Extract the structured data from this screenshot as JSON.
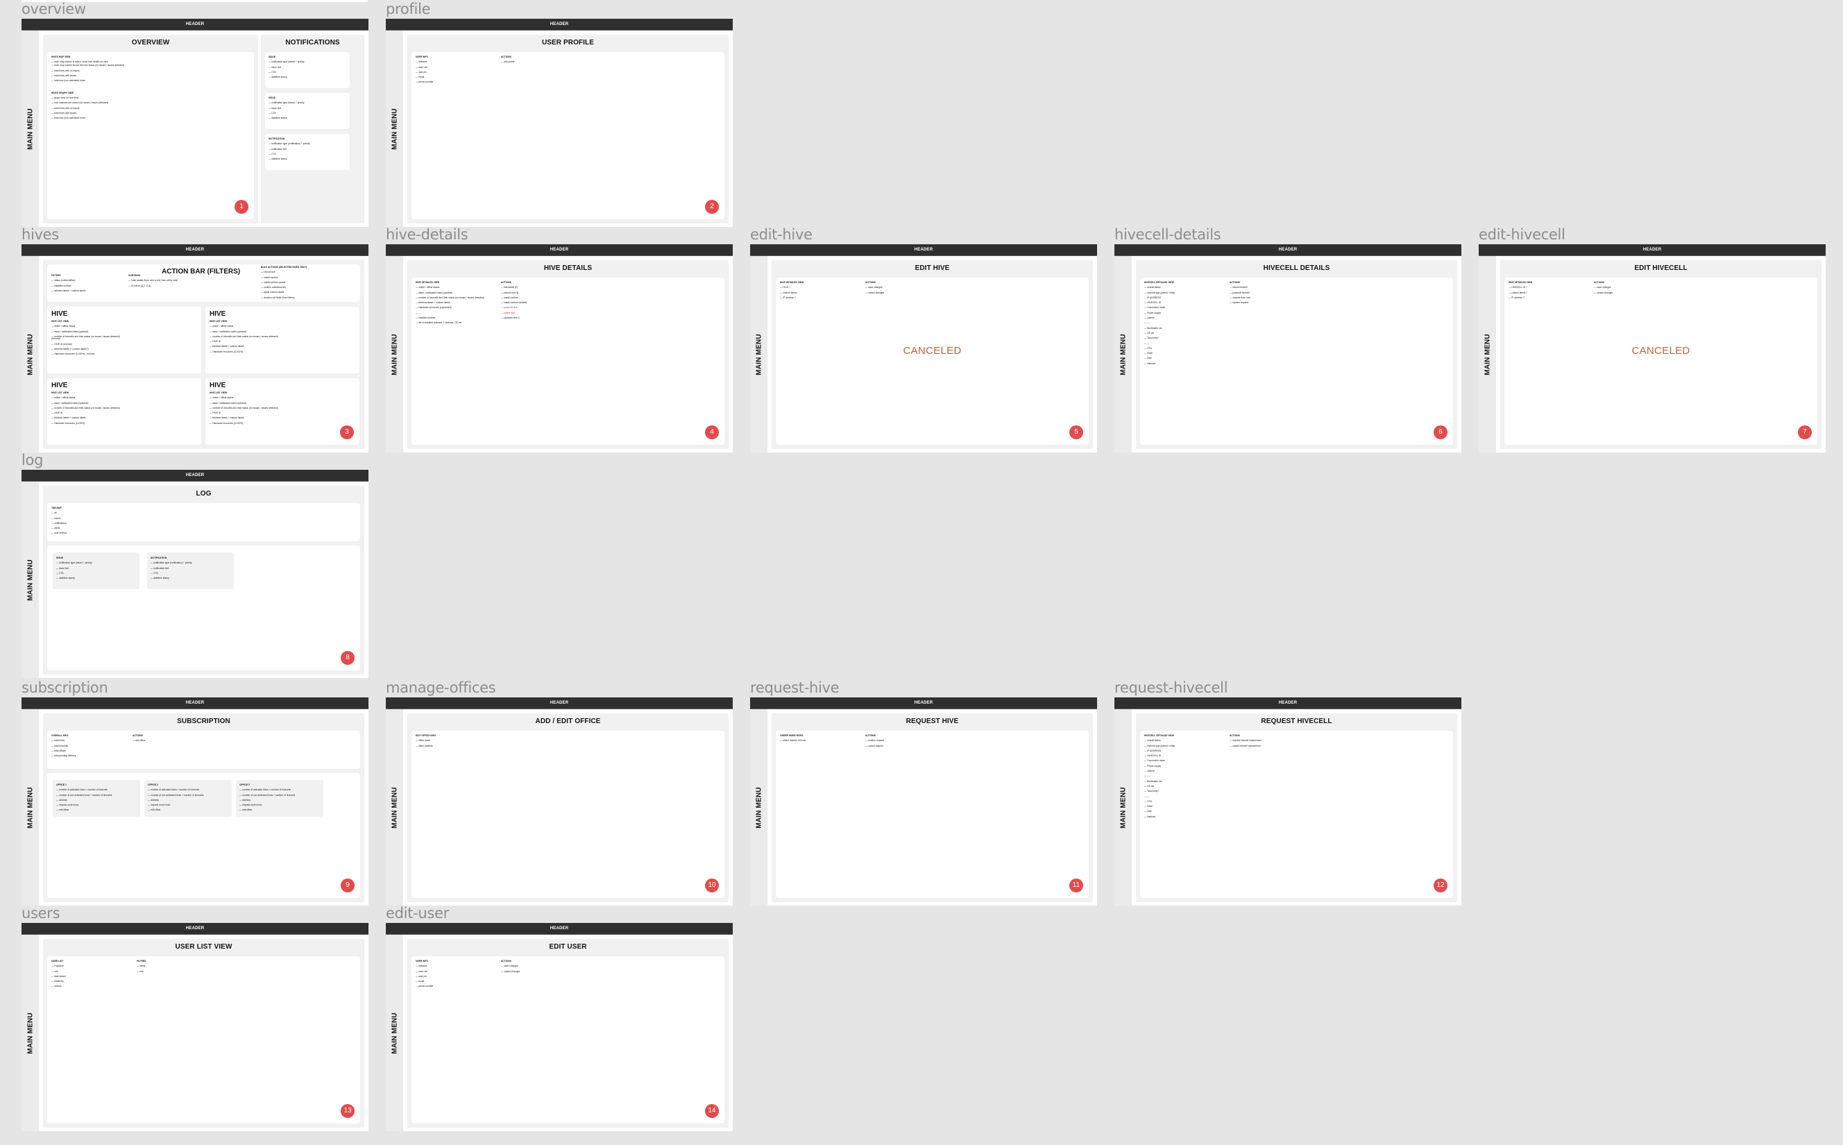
{
  "canvas": {
    "background": "#e5e5e5"
  },
  "common": {
    "header_label": "HEADER",
    "sidebar_label": "MAIN MENU",
    "badge_color": "#e34b4b",
    "canceled_color": "#d35b3a"
  },
  "frames": {
    "overview": {
      "label": "overview",
      "badge": "1",
      "title": "OVERVIEW",
      "sections": [
        {
          "heading": "HIVES MAP VIEW",
          "items": [
            "each map marker is active, show hive details on click",
            "each map marker shows the hive status (no issues / issues detected)",
            "total hives with no issues",
            "total hives with issues",
            "total new (non-activated) hives"
          ]
        },
        {
          "heading": "HIVES GRAPH VIEW",
          "items": [
            "graph view on hive level",
            "hive statuses are shown (no issues / issues detected)",
            "total hives with no issues",
            "total hives with issues",
            "total new (non-activated) hives"
          ]
        }
      ],
      "notifications": {
        "title": "NOTIFICATIONS",
        "cards": [
          {
            "heading": "ISSUE",
            "items": [
              "notification type (issue) + priority",
              "issue text",
              "CTA",
              "datetime stamp"
            ]
          },
          {
            "heading": "ISSUE",
            "items": [
              "notification type (issue) + priority",
              "issue text",
              "CTA",
              "datetime stamp"
            ]
          },
          {
            "heading": "NOTIFICATION",
            "items": [
              "notification type (notification) + priority",
              "notification text",
              "CTA",
              "datetime stamp"
            ]
          }
        ]
      }
    },
    "profile": {
      "label": "profile",
      "badge": "2",
      "title": "USER PROFILE",
      "left": {
        "heading": "USER INFO",
        "items": [
          "fullname",
          "user role",
          "user pic",
          "email",
          "phone number"
        ]
      },
      "right": {
        "heading": "ACTIONS",
        "items": [
          "edit profile"
        ]
      }
    },
    "hives": {
      "label": "hives",
      "badge": "3",
      "action_bar": {
        "title": "ACTION BAR (FILTERS)",
        "filters": {
          "heading": "FILTERS",
          "items": [
            "status (online/offline)",
            "installed runtime",
            "address labels + custom labels"
          ]
        },
        "sortings": {
          "heading": "SORTINGS",
          "items": [
            "Date added (from new to old, from old to new)",
            "ID name (A-Z, Z-A)"
          ]
        },
        "bulk": {
          "heading": "BULK ACTIONS (SELECTED HIVES ONLY)",
          "items": [
            "reboot hive",
            "install runtime",
            "install runtime update",
            "confirm autodiscovery",
            "apply custom labels",
            "deselect all hives (reset filters)"
          ]
        }
      },
      "hive_cards": [
        {
          "title": "HIVE",
          "heading": "HIVE LIST VIEW",
          "items": [
            "online / offline status",
            "issue / notification label (optional)",
            "number of hivecells and their status (no issues / issues detected) (remove)",
            "HIVE ID (remove)",
            "Address labels (+ custom labels?)",
            "Hardware resources (0-100%) - remove"
          ]
        },
        {
          "title": "HIVE",
          "heading": "HIVE LIST VIEW",
          "items": [
            "online / offline status",
            "issue / notification label (optional)",
            "number of hivecells and their status (no issues / issues detected)",
            "HIVE ID",
            "Address labels + custom labels",
            "Hardware resources (0-100%)"
          ]
        },
        {
          "title": "HIVE",
          "heading": "HIVE LIST VIEW",
          "items": [
            "online / offline status",
            "issue / notification label (optional)",
            "number of hivecells and their status (no issues / issues detected)",
            "HIVE ID",
            "Address labels + custom labels",
            "Hardware resources (0-100%)"
          ]
        },
        {
          "title": "HIVE",
          "heading": "HIVE LIST VIEW",
          "items": [
            "online / offline status",
            "issue / notification label (optional)",
            "number of hivecells and their status (no issues / issues detected)",
            "HIVE ID",
            "Address labels + custom labels",
            "Hardware resources (0-100%)"
          ]
        }
      ]
    },
    "hive_details": {
      "label": "hive-details",
      "badge": "4",
      "title": "HIVE DETAILS",
      "left": {
        "heading": "HIVE DETAILED VIEW",
        "items": [
          "online / offline status",
          "issue / notification label (optional)",
          "number of hivecells and their status (no issues / issues detected)",
          "Address labels + custom labels",
          "Hardware resources (expanded)",
          "----",
          "installed runtime",
          "list of installed software + versions, OS ver"
        ]
      },
      "right": {
        "heading": "ACTIONS",
        "items": [
          {
            "text": "edit labels [2]",
            "danger": false
          },
          {
            "text": "reboot hive [3]",
            "danger": false
          },
          {
            "text": "install runtime",
            "danger": false
          },
          {
            "text": "install runtime updates",
            "danger": false
          },
          {
            "text": "poweroff hive",
            "danger": true
          },
          {
            "text": "delete hive",
            "danger": true
          },
          {
            "text": "(activate hive?)",
            "danger": false
          }
        ]
      }
    },
    "edit_hive": {
      "label": "edit-hive",
      "badge": "5",
      "title": "EDIT HIVE",
      "status": "CANCELED",
      "left": {
        "heading": "HIVE DETAILED VIEW",
        "items": [
          "HCID ?",
          "custom labels",
          "IP address ?"
        ]
      },
      "right": {
        "heading": "ACTIONS",
        "items": [
          "save changes",
          "cancel changes"
        ]
      }
    },
    "hivecell_details": {
      "label": "hivecell-details",
      "badge": "6",
      "title": "HIVECELL DETAILS",
      "left": {
        "heading": "HIVECELL DETAILED VIEW",
        "items": [
          "overall status",
          "hivecell type (parent / child)",
          "IP ADDRESS",
          "HIVECELL ID",
          "Connection mode",
          "Power supply",
          "Uptime",
          "----",
          "Bootloader ver",
          "OS ver",
          "Taxonomy?",
          "---",
          "CPU",
          "RAM",
          "Disk",
          "Network"
        ]
      },
      "right": {
        "heading": "ACTIONS",
        "items": [
          "reboot hivecell",
          "poweroff hivecell",
          "exclude from hive",
          "replace request"
        ]
      }
    },
    "edit_hivecell": {
      "label": "edit-hivecell",
      "badge": "7",
      "title": "EDIT HIVECELL",
      "status": "CANCELED",
      "left": {
        "heading": "HIVE DETAILED VIEW",
        "items": [
          "HIVECELL ID ?",
          "custom labels ?",
          "IP address ?"
        ]
      },
      "right": {
        "heading": "ACTIONS",
        "items": [
          "save changes",
          "cancel changes"
        ]
      }
    },
    "log": {
      "label": "log",
      "badge": "8",
      "title": "LOG",
      "tab_bar": {
        "heading": "TAB BAR",
        "items": [
          "all",
          "issues",
          "notifications",
          "alerts",
          "user actions"
        ]
      },
      "cards": [
        {
          "heading": "ISSUE",
          "items": [
            "notification type (issue) + priority",
            "issue text",
            "CTA",
            "datetime stamp"
          ]
        },
        {
          "heading": "NOTIFICATION",
          "items": [
            "notification type (notification) + priority",
            "notification text",
            "CTA",
            "datetime stamp"
          ]
        }
      ]
    },
    "subscription": {
      "label": "subscription",
      "badge": "9",
      "title": "SUBSCRIPTION",
      "left": {
        "heading": "OVERALL INFO",
        "items": [
          "total hives",
          "total hivecells",
          "total offices",
          "total pending delivery"
        ]
      },
      "right": {
        "heading": "ACTIONS",
        "items": [
          "add office"
        ]
      },
      "offices": [
        {
          "heading": "OFFICE 1",
          "items": [
            "number of activated hives + number of hivecells",
            "number of non activated hives + number of hivecells",
            "address",
            "request more hives",
            "edit office"
          ]
        },
        {
          "heading": "OFFICE 2",
          "items": [
            "number of activated hives + number of hivecells",
            "number of non activated hives + number of hivecells",
            "address",
            "request more hives",
            "edit office"
          ]
        },
        {
          "heading": "OFFICE 3",
          "items": [
            "number of activated hives + number of hivecells",
            "number of non activated hives + number of hivecells",
            "address",
            "request more hives",
            "edit office"
          ]
        }
      ]
    },
    "manage_offices": {
      "label": "manage-offices",
      "badge": "10",
      "title": "ADD / EDIT OFFICE",
      "left": {
        "heading": "EDIT OFFICE INFO",
        "items": [
          "office name",
          "office address"
        ]
      }
    },
    "request_hive": {
      "label": "request-hive",
      "badge": "11",
      "title": "REQUEST HIVE",
      "left": {
        "heading": "ORDER MORE HIVES",
        "items": [
          "select number of hives"
        ]
      },
      "right": {
        "heading": "ACTIONS",
        "items": [
          "confirm request",
          "cancel request"
        ]
      }
    },
    "request_hivecell": {
      "label": "request-hivecell",
      "badge": "12",
      "title": "REQUEST HIVECELL",
      "left": {
        "heading": "HIVECELL DETAILED VIEW",
        "items": [
          "overall status",
          "hivecell type (parent / child)",
          "IP ADDRESS",
          "HIVECELL ID",
          "Connection mode",
          "Power supply",
          "Uptime",
          "----",
          "Bootloader ver",
          "OS ver",
          "Taxonomy?",
          "---",
          "CPU",
          "RAM",
          "Disk",
          "Network"
        ]
      },
      "right": {
        "heading": "ACTIONS",
        "items": [
          "request hivecell replacement",
          "cancel hivecell replacement"
        ]
      }
    },
    "users": {
      "label": "users",
      "badge": "13",
      "title": "USER LIST VIEW",
      "left": {
        "heading": "USER LIST",
        "items": [
          "Fullname",
          "role",
          "date added",
          "added by",
          "userpic"
        ]
      },
      "right": {
        "heading": "FILTERS",
        "items": [
          "name",
          "role"
        ]
      }
    },
    "edit_user": {
      "label": "edit-user",
      "badge": "14",
      "title": "EDIT USER",
      "left": {
        "heading": "USER INFO",
        "items": [
          "fullname",
          "user role",
          "user pic",
          "email",
          "phone number"
        ]
      },
      "right": {
        "heading": "ACTIONS",
        "items": [
          "save changes",
          "cancel changes"
        ]
      }
    }
  }
}
